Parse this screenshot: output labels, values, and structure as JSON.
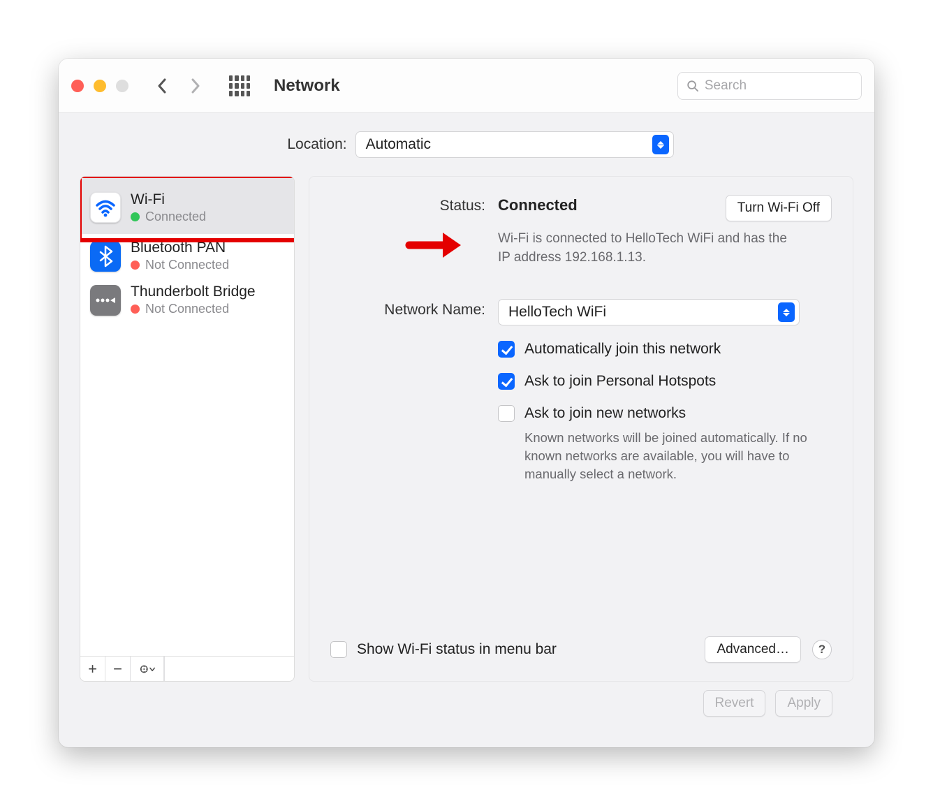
{
  "toolbar": {
    "title": "Network",
    "search_placeholder": "Search"
  },
  "location": {
    "label": "Location:",
    "value": "Automatic"
  },
  "services": [
    {
      "name": "Wi-Fi",
      "status": "Connected",
      "status_color": "green",
      "icon": "wifi",
      "selected": true
    },
    {
      "name": "Bluetooth PAN",
      "status": "Not Connected",
      "status_color": "red",
      "icon": "bt",
      "selected": false
    },
    {
      "name": "Thunderbolt Bridge",
      "status": "Not Connected",
      "status_color": "red",
      "icon": "tb",
      "selected": false
    }
  ],
  "details": {
    "status_label": "Status:",
    "status_value": "Connected",
    "status_desc": "Wi-Fi is connected to HelloTech WiFi and has the IP address 192.168.1.13.",
    "turn_off_label": "Turn Wi-Fi Off",
    "network_name_label": "Network Name:",
    "network_name_value": "HelloTech WiFi",
    "auto_join_label": "Automatically join this network",
    "auto_join_checked": true,
    "ask_hotspots_label": "Ask to join Personal Hotspots",
    "ask_hotspots_checked": true,
    "ask_new_label": "Ask to join new networks",
    "ask_new_checked": false,
    "ask_new_desc": "Known networks will be joined automatically. If no known networks are available, you will have to manually select a network.",
    "show_menubar_label": "Show Wi-Fi status in menu bar",
    "show_menubar_checked": false,
    "advanced_label": "Advanced…"
  },
  "footer": {
    "revert_label": "Revert",
    "apply_label": "Apply"
  },
  "colors": {
    "highlight": "#e40000",
    "accent": "#0a66ff"
  }
}
